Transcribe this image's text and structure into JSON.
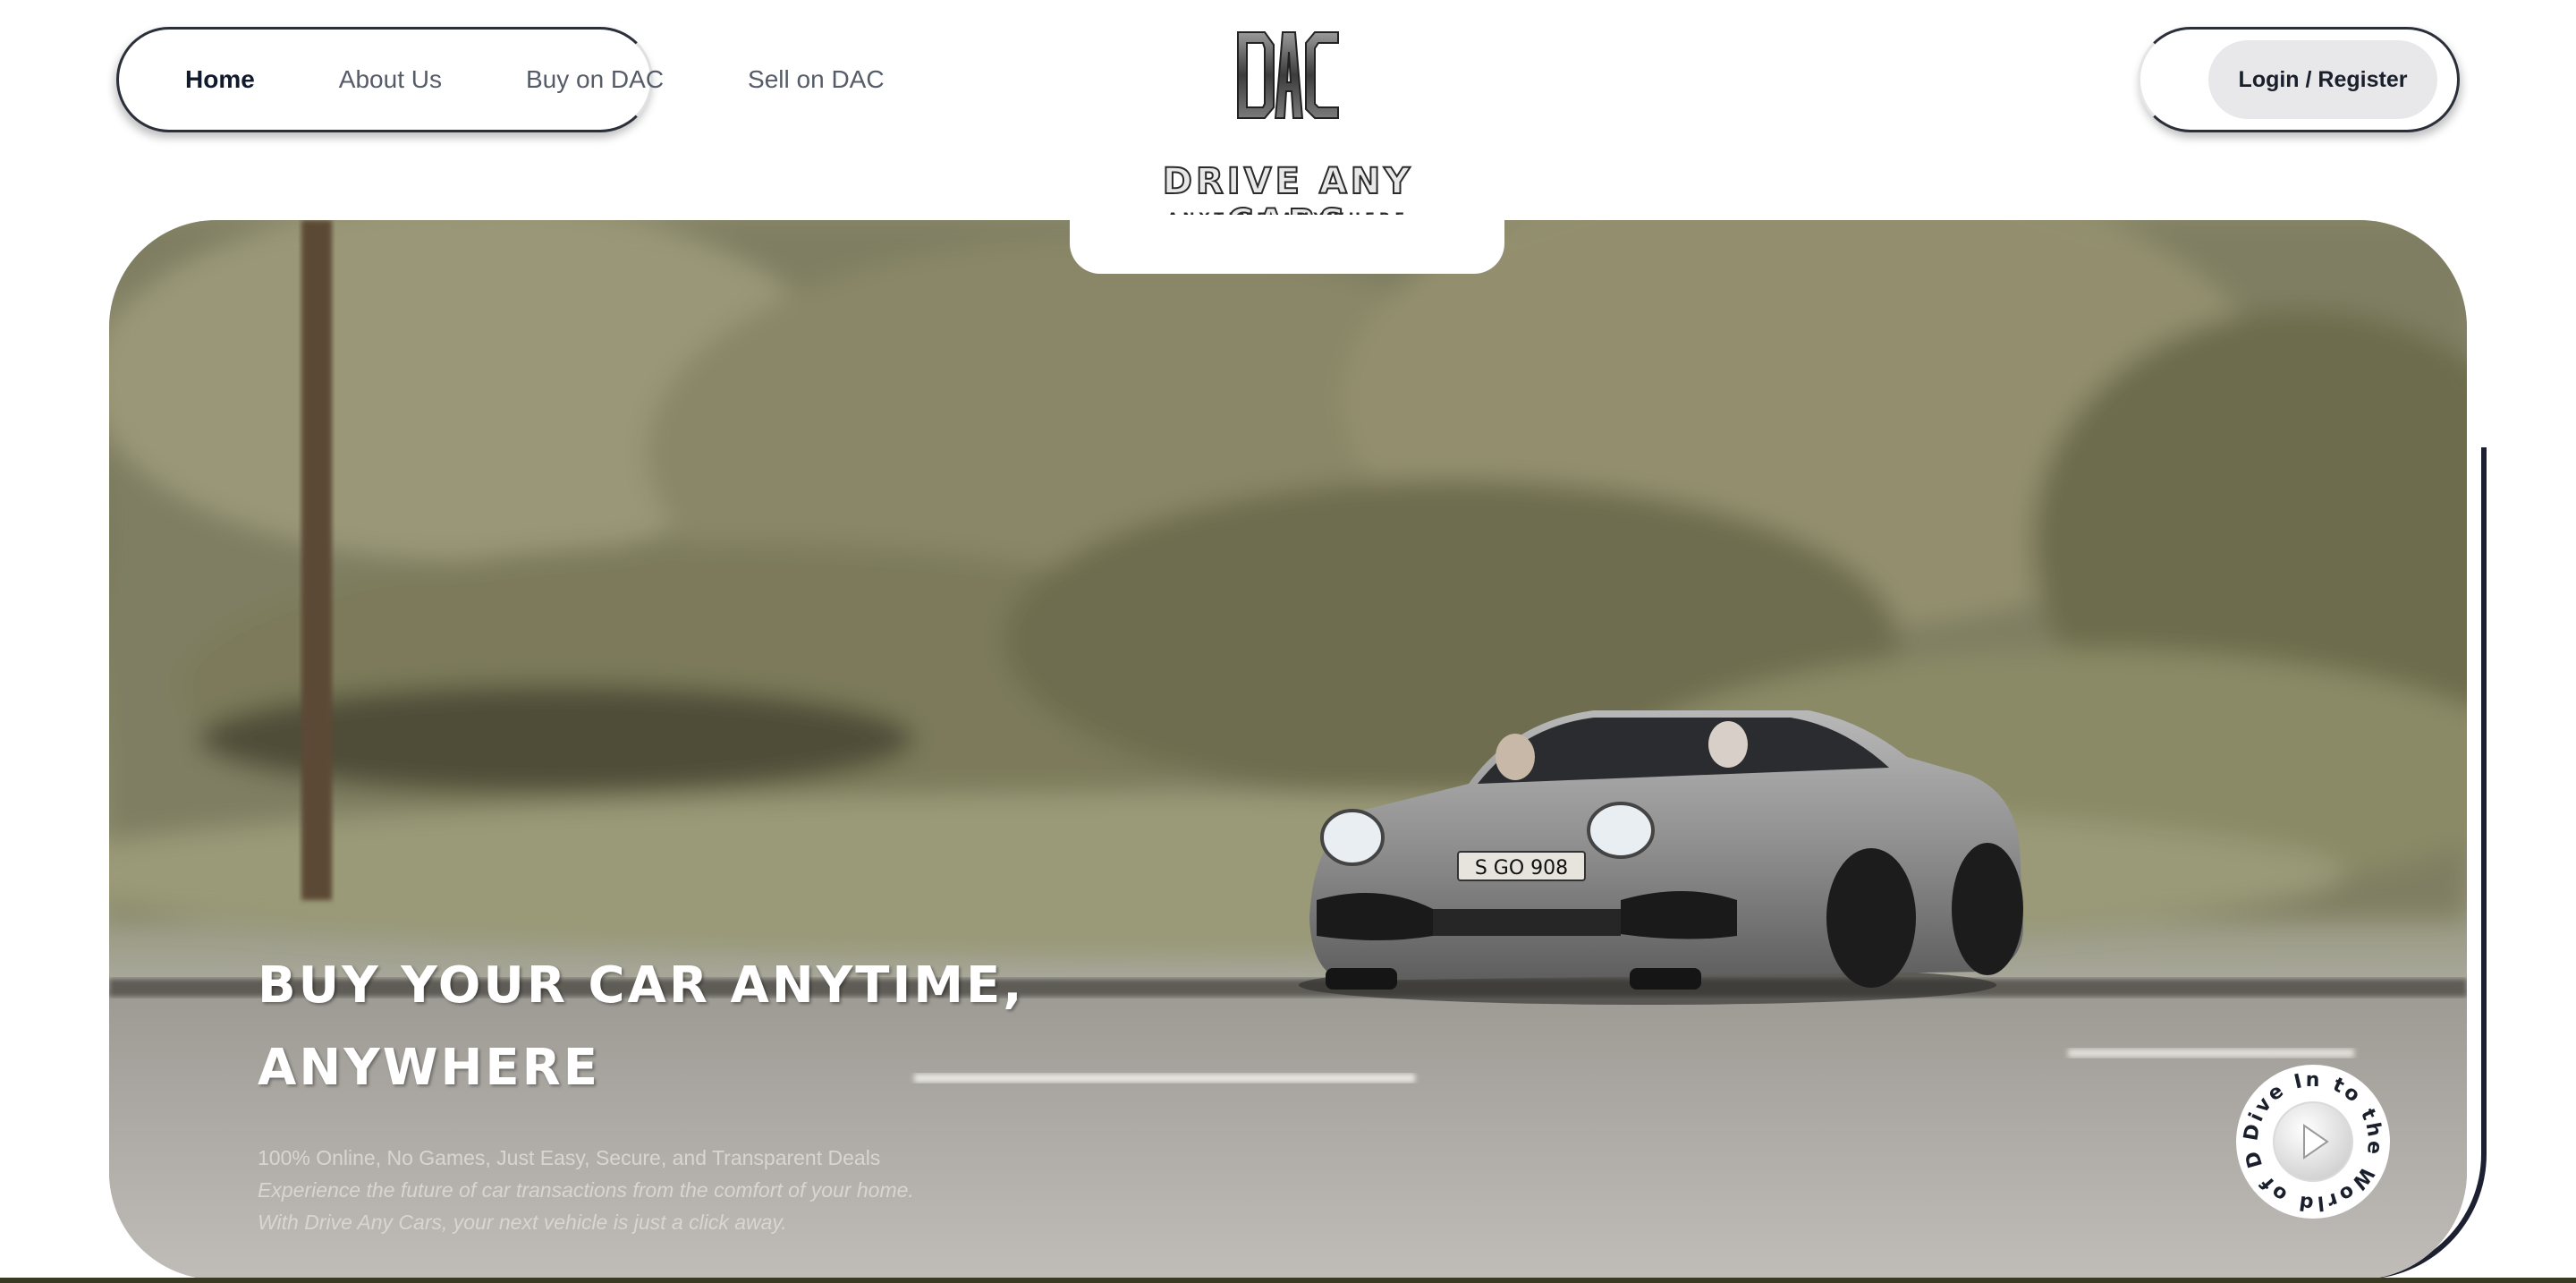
{
  "nav": {
    "items": [
      {
        "label": "Home",
        "active": true
      },
      {
        "label": "About Us",
        "active": false
      },
      {
        "label": "Buy on DAC",
        "active": false
      },
      {
        "label": "Sell on DAC",
        "active": false
      }
    ],
    "login_label": "Login / Register"
  },
  "logo": {
    "mark": "DAC",
    "name": "DRIVE ANY CARS",
    "tagline": "ANYTIME-ANYWHERE"
  },
  "hero": {
    "title_line1": "BUY YOUR CAR ANYTIME,",
    "title_line2": "ANYWHERE",
    "subtitle_line1": "100% Online, No Games, Just Easy, Secure, and Transparent Deals",
    "subtitle_line2": "Experience the future of car transactions from the comfort of your home.",
    "subtitle_line3": "With Drive Any Cars, your next vehicle is just a click away.",
    "plate": "S GO 908",
    "badge_text": "Dive In to the World of DAC",
    "badge_icon": "play-icon"
  },
  "colors": {
    "nav_border": "#2b2f3a",
    "login_bg": "#e8e8ea",
    "text_dark": "#111a2c",
    "text_muted": "#555c68"
  }
}
